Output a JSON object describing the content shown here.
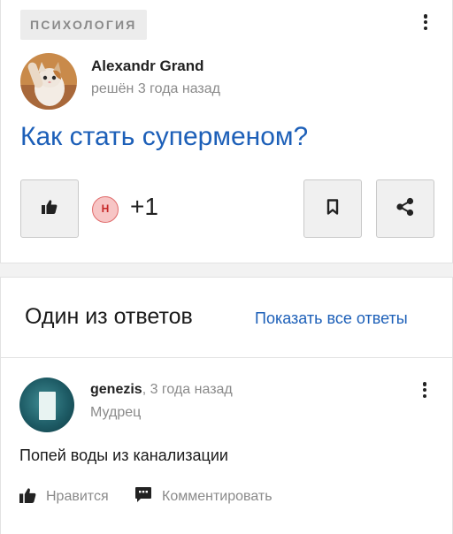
{
  "question": {
    "category": "ПСИХОЛОГИЯ",
    "author_name": "Alexandr Grand",
    "author_meta": "решён 3 года назад",
    "title": "Как стать суперменом?",
    "reactor_initial": "Н",
    "like_count": "+1"
  },
  "answers": {
    "heading": "Один из ответов",
    "show_all_label": "Показать все ответы"
  },
  "answer": {
    "author_name": "genezis",
    "time_suffix": ", 3 года назад",
    "rank": "Мудрец",
    "text": "Попей воды из канализации",
    "like_label": "Нравится",
    "comment_label": "Комментировать"
  },
  "colors": {
    "link_blue": "#1c5fb8",
    "muted_gray": "#8a8a8a",
    "reactor_pink": "#f7c5c5",
    "reactor_red": "#c62828"
  },
  "icons": [
    "kebab-menu-icon",
    "thumbs-up-icon",
    "bookmark-icon",
    "share-icon",
    "comment-icon"
  ]
}
